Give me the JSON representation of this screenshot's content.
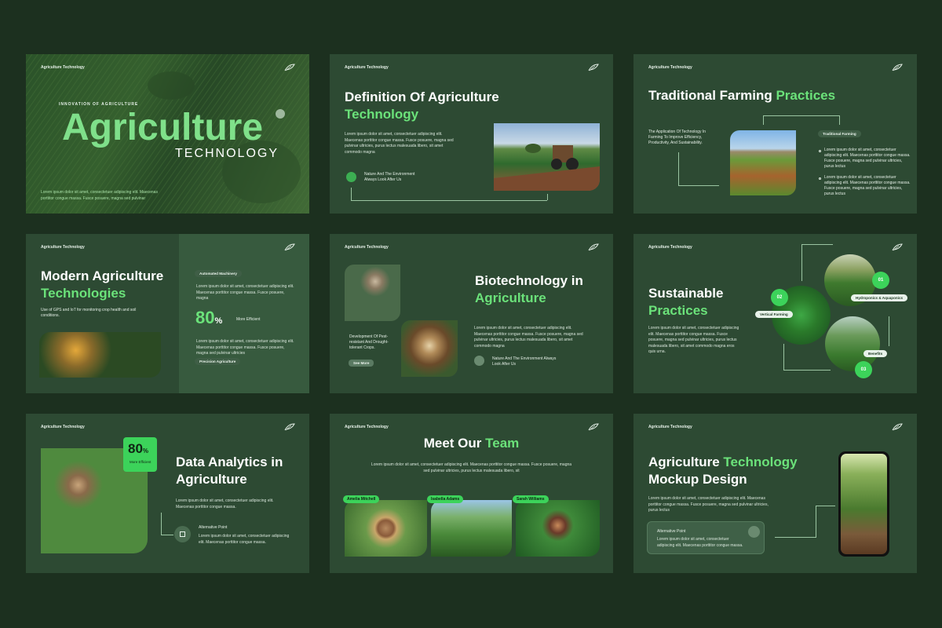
{
  "brand": "Agriculture Technology",
  "colors": {
    "background": "#1c301f",
    "slide": "#2d4a33",
    "accent": "#6be27a",
    "badge": "#3cd35a"
  },
  "lorem_short": "Lorem ipsum dolor sit amet, consectetuer adipiscing elit. Maecenas porttitor congue massa.",
  "s1": {
    "kicker": "INNOVATION OF AGRICULTURE",
    "title": "Agriculture",
    "subtitle": "TECHNOLOGY",
    "body": "Lorem ipsum dolor sit amet, consectetuer adipiscing elit. Maecenas porttitor congue massa. Fusce posuere, magna sed pulvinar"
  },
  "s2": {
    "title_a": "Definition Of Agriculture",
    "title_b": "Technology",
    "body": "Lorem ipsum dolor sit amet, consectetuer adipiscing elit. Maecenas porttitor congue massa. Fusce posuere, magna sed pulvinar ultricies, purus lectus malesuada libero, sit amet commodo magna",
    "note": "Nature And The Environment Always Look After Us"
  },
  "s3": {
    "title_a": "Traditional Farming ",
    "title_b": "Practices",
    "left": "The Application Of Technology In Farming To Improve Efficiency, Productivity, And Sustainability.",
    "tag": "Traditional Farming",
    "b1": "Lorem ipsum dolor sit amet, consectetuer adipiscing elit. Maecenas porttitor congue massa. Fusce posuere, magna sed pulvinar ultricies, purus lectus",
    "b2": "Lorem ipsum dolor sit amet, consectetuer adipiscing elit. Maecenas porttitor congue massa. Fusce posuere, magna sed pulvinar ultricies, purus lectus"
  },
  "s4": {
    "title_a": "Modern Agriculture",
    "title_b": "Technologies",
    "desc": "Use of GPS and IoT for monitoring crop health and soil conditions.",
    "tag1": "Automated Machinery",
    "body1": "Lorem ipsum dolor sit amet, consectetuer adipiscing elit. Maecenas porttitor congue massa. Fusce posuere, magna",
    "stat": "80",
    "stat_unit": "%",
    "stat_label": "More Efficient",
    "body2": "Lorem ipsum dolor sit amet, consectetuer adipiscing elit. Maecenas porttitor congue massa. Fusce posuere, magna sed pulvinar ultricies",
    "tag2": "Precision Agriculture"
  },
  "s5": {
    "title_a": "Biotechnology in",
    "title_b": "Agriculture",
    "dev": "Development Of Pest-resistant And Drought-tolerant Crops.",
    "button": "See More",
    "body": "Lorem ipsum dolor sit amet, consectetuer adipiscing elit. Maecenas porttitor congue massa. Fusce posuere, magna sed pulvinar ultricies, purus lectus malesuada libero, sit amet commodo magna",
    "note": "Nature And The Environment Always Look After Us"
  },
  "s6": {
    "title_a": "Sustainable",
    "title_b": "Practices",
    "body": "Lorem ipsum dolor sit amet, consectetuer adipiscing elit. Maecenas porttitor congue massa. Fusce posuere, magna sed pulvinar ultricies, purus lectus malesuada libero, sit amet commodo magna eros quis urna.",
    "n1": "01",
    "l1": "Hydroponics & Aquaponics",
    "n2": "02",
    "l2": "Vertical Farming",
    "n3": "03",
    "l3": "Benefits"
  },
  "s7": {
    "stat": "80",
    "stat_unit": "%",
    "stat_label": "More Efficient",
    "title_a": "Data Analytics in",
    "title_b": "Agriculture",
    "body": "Lorem ipsum dolor sit amet, consectetuer adipiscing elit. Maecenas porttitor congue massa.",
    "alt": "Alternative Point",
    "alt_body": "Lorem ipsum dolor sit amet, consectetuer adipiscing elit. Maecenas porttitor congue massa."
  },
  "s8": {
    "title_a": "Meet Our ",
    "title_b": "Team",
    "body": "Lorem ipsum dolor sit amet, consectetuer adipiscing elit. Maecenas porttitor congue massa. Fusce posuere, magna sed pulvinar ultricies, purus lectus malesuada libero, sit",
    "members": [
      "Amelia Mitchell",
      "Isabella Adams",
      "Sarah Williams"
    ]
  },
  "s9": {
    "title_a": "Agriculture ",
    "title_b": "Technology",
    "title_c": "Mockup Design",
    "body": "Lorem ipsum dolor sit amet, consectetuer adipiscing elit. Maecenas porttitor congue massa. Fusce posuere, magna sed pulvinar ultricies, purus lectus",
    "alt": "Alternative Point",
    "alt_body": "Lorem ipsum dolor sit amet, consectetuer adipiscing elit. Maecenas porttitor congue massa."
  }
}
